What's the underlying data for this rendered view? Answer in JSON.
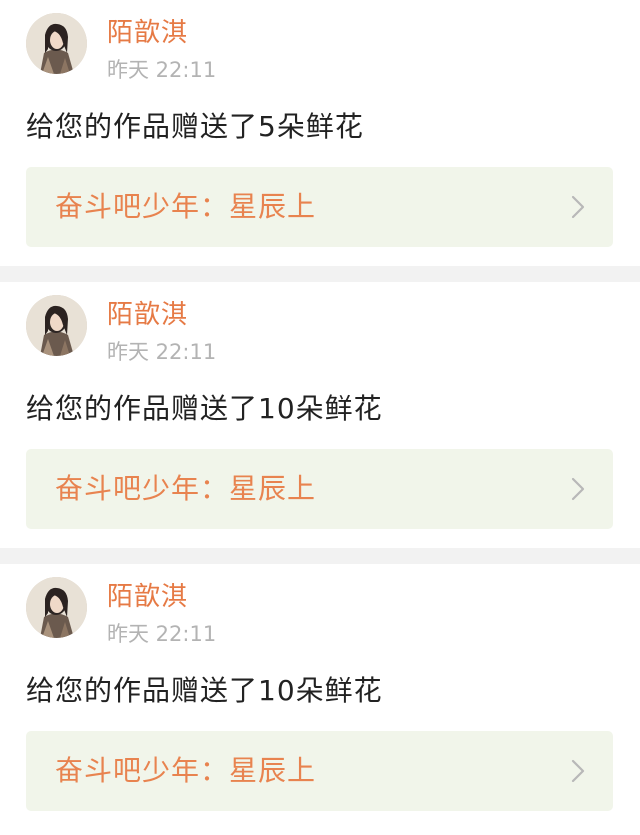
{
  "notifications": [
    {
      "user_name": "陌歆淇",
      "time": "昨天 22:11",
      "message": "给您的作品赠送了5朵鲜花",
      "work_title": "奋斗吧少年：星辰上",
      "chevron_icon": "chevron-right-icon"
    },
    {
      "user_name": "陌歆淇",
      "time": "昨天 22:11",
      "message": "给您的作品赠送了10朵鲜花",
      "work_title": "奋斗吧少年：星辰上",
      "chevron_icon": "chevron-right-icon"
    },
    {
      "user_name": "陌歆淇",
      "time": "昨天 22:11",
      "message": "给您的作品赠送了10朵鲜花",
      "work_title": "奋斗吧少年：星辰上",
      "chevron_icon": "chevron-right-icon"
    }
  ],
  "colors": {
    "user_name": "#e67a45",
    "work_title": "#e8834f",
    "work_link_bg": "#f1f5ea",
    "timestamp": "#b3b3b3",
    "message": "#222222",
    "separator": "#f2f2f2"
  }
}
